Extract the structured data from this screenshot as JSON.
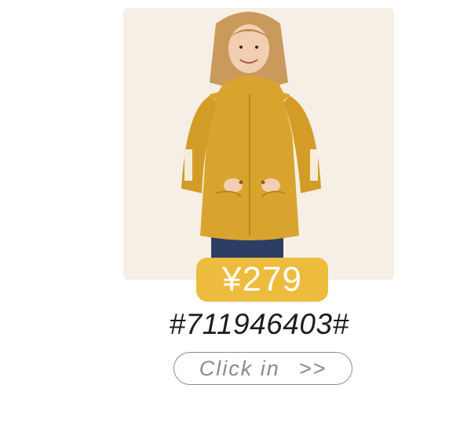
{
  "product": {
    "price": "¥279",
    "code": "#711946403#",
    "cta_label": "Click in",
    "cta_arrow": ">>"
  },
  "colors": {
    "badge": "#edbb3d",
    "photo_background": "#f6efe6",
    "jacket": "#d9a42e",
    "button_border": "#8c8c8c"
  }
}
